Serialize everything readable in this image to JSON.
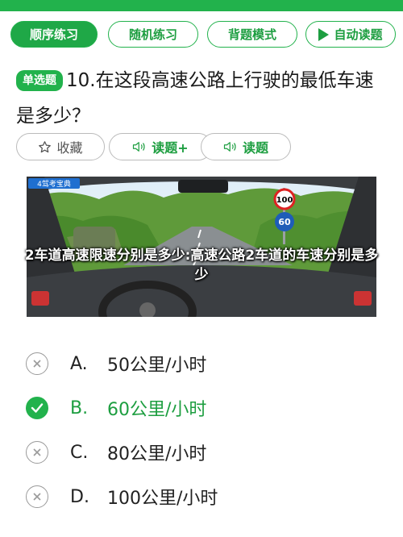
{
  "tabs": [
    {
      "label": "顺序练习",
      "active": true
    },
    {
      "label": "随机练习",
      "active": false
    },
    {
      "label": "背题模式",
      "active": false
    },
    {
      "label": "自动读题",
      "active": false,
      "icon": "play-icon"
    }
  ],
  "question": {
    "type_badge": "单选题",
    "text": "10.在这段高速公路上行驶的最低车速是多少？"
  },
  "actions": {
    "favorite": "收藏",
    "read_plus": "读题+",
    "read": "读题"
  },
  "image": {
    "watermark": "4驾考宝典",
    "sign_top": "100",
    "sign_bottom": "60",
    "caption": "2车道高速限速分别是多少:高速公路2车道的车速分别是多少"
  },
  "options": [
    {
      "letter": "A.",
      "text": "50公里/小时",
      "state": "wrong"
    },
    {
      "letter": "B.",
      "text": "60公里/小时",
      "state": "correct"
    },
    {
      "letter": "C.",
      "text": "80公里/小时",
      "state": "wrong"
    },
    {
      "letter": "D.",
      "text": "100公里/小时",
      "state": "wrong"
    }
  ],
  "colors": {
    "accent": "#22b24c",
    "accent_text": "#1d9e40",
    "muted": "#9a9a9a"
  }
}
